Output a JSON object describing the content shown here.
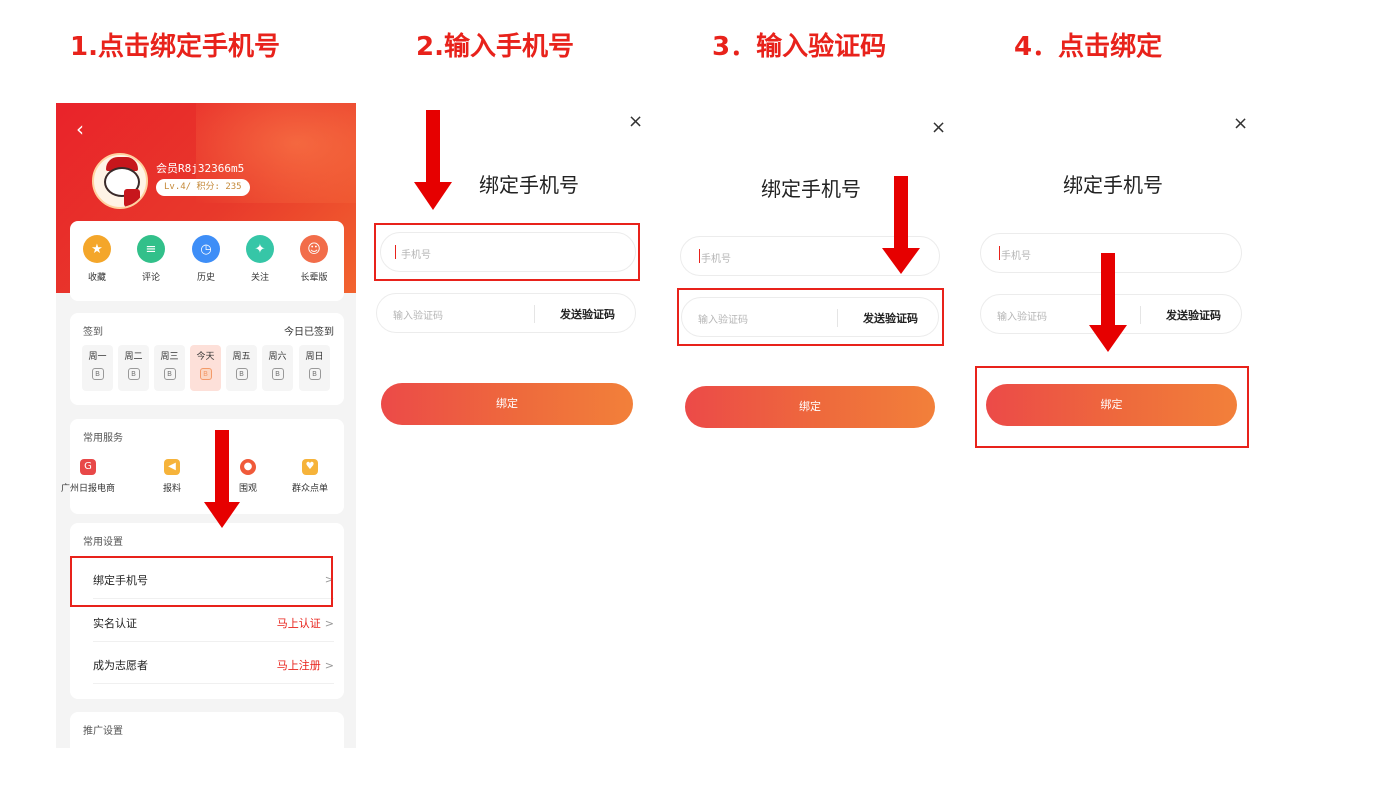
{
  "steps": [
    {
      "title": "1.点击绑定手机号"
    },
    {
      "title": "2.输入手机号"
    },
    {
      "title": "3．输入验证码"
    },
    {
      "title": "4．点击绑定"
    }
  ],
  "profile": {
    "back_icon": "‹",
    "username": "会员R8j32366m5",
    "level": "Lv.4/ 积分: 235",
    "quick_links": [
      {
        "label": "收藏",
        "icon": "star-icon",
        "color": "#f4a62a",
        "glyph": "★"
      },
      {
        "label": "评论",
        "icon": "comment-icon",
        "color": "#32c08a",
        "glyph": "≡"
      },
      {
        "label": "历史",
        "icon": "clock-icon",
        "color": "#3e8ef7",
        "glyph": "◷"
      },
      {
        "label": "关注",
        "icon": "follow-icon",
        "color": "#36c6a7",
        "glyph": "✦"
      },
      {
        "label": "长辈版",
        "icon": "elder-icon",
        "color": "#f26d4a",
        "glyph": "☺"
      }
    ],
    "checkin": {
      "title": "签到",
      "status": "今日已签到",
      "days": [
        "周一",
        "周二",
        "周三",
        "今天",
        "周五",
        "周六",
        "周日"
      ]
    },
    "services": {
      "title": "常用服务",
      "items": [
        {
          "label": "广州日报电商",
          "icon": "shop-icon",
          "color": "#e84848",
          "glyph": "G"
        },
        {
          "label": "报料",
          "icon": "megaphone-icon",
          "color": "#f6b33a",
          "glyph": "◀"
        },
        {
          "label": "围观",
          "icon": "eye-icon",
          "color": "#f05a3a",
          "glyph": "●"
        },
        {
          "label": "群众点单",
          "icon": "heart-icon",
          "color": "#f6b33a",
          "glyph": "♥"
        }
      ]
    },
    "settings": {
      "title": "常用设置",
      "rows": [
        {
          "label": "绑定手机号",
          "action": "",
          "chevron": ">"
        },
        {
          "label": "实名认证",
          "action": "马上认证",
          "chevron": ">"
        },
        {
          "label": "成为志愿者",
          "action": "马上注册",
          "chevron": ">"
        }
      ]
    },
    "promo": {
      "title": "推广设置"
    }
  },
  "bind_form": {
    "title": "绑定手机号",
    "close_icon": "×",
    "phone_placeholder": "手机号",
    "code_placeholder": "输入验证码",
    "send_code_label": "发送验证码",
    "bind_button_label": "绑定"
  },
  "colors": {
    "accent": "#e8221b",
    "button_gradient_start": "#ec4a48",
    "button_gradient_end": "#f2803a"
  }
}
